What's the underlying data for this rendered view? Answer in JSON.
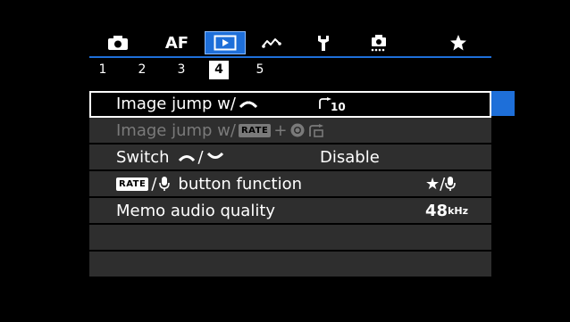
{
  "tabs": [
    {
      "name": "camera-tab-icon",
      "label": ""
    },
    {
      "name": "af-tab",
      "label": "AF"
    },
    {
      "name": "playback-tab-icon",
      "label": "",
      "active": true
    },
    {
      "name": "custom-wave-tab-icon",
      "label": ""
    },
    {
      "name": "wrench-tab-icon",
      "label": ""
    },
    {
      "name": "custom-functions-tab-icon",
      "label": ""
    },
    {
      "name": "my-menu-star-tab-icon",
      "label": ""
    }
  ],
  "pages": [
    "1",
    "2",
    "3",
    "4",
    "5"
  ],
  "active_page": "4",
  "menu": {
    "items": [
      {
        "label": "Image jump w/",
        "value": "10",
        "selected": true
      },
      {
        "label": "Image jump w/",
        "label2": "RATE",
        "label3": "+",
        "dimmed": true
      },
      {
        "label": "Switch",
        "label2": "/",
        "value": "Disable"
      },
      {
        "label": "RATE",
        "label2": "/",
        "label3": "button function",
        "value": "★/"
      },
      {
        "label": "Memo audio quality",
        "value": "48",
        "unit": "kHz"
      }
    ]
  },
  "colors": {
    "accent": "#1e6fd9",
    "row_bg": "#2e2e2e",
    "dim_text": "#7a7a7a"
  }
}
